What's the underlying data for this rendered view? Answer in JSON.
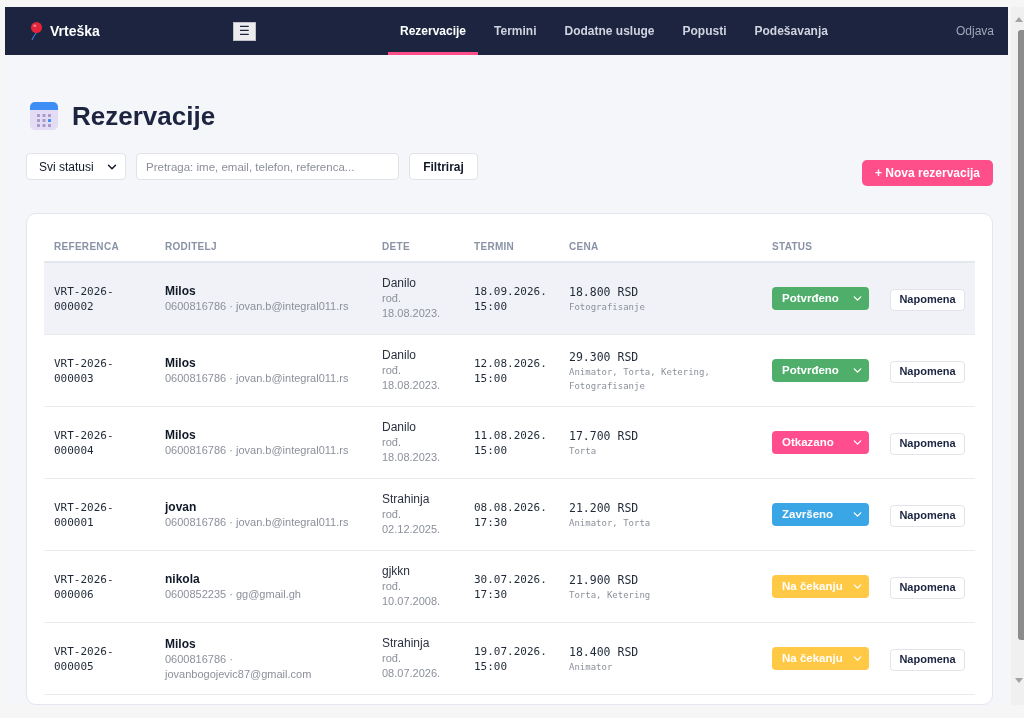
{
  "nav": {
    "brand": "Vrteška",
    "menu_button": "☰",
    "links": [
      {
        "label": "Rezervacije",
        "selected": true
      },
      {
        "label": "Termini",
        "selected": false
      },
      {
        "label": "Dodatne usluge",
        "selected": false
      },
      {
        "label": "Popusti",
        "selected": false
      },
      {
        "label": "Podešavanja",
        "selected": false
      }
    ],
    "logout": "Odjava"
  },
  "page": {
    "title": "Rezervacije"
  },
  "filters": {
    "status_select": "Svi statusi",
    "search": {
      "placeholder": "Pretraga: ime, email, telefon, referenca..."
    },
    "filter_button": "Filtriraj",
    "new_button": "+ Nova rezervacija"
  },
  "table": {
    "columns": [
      "REFERENCA",
      "RODITELJ",
      "DETE",
      "TERMIN",
      "CENA",
      "STATUS"
    ],
    "rows": [
      {
        "reference": "VRT-2026-000002",
        "parent_name": "Milos",
        "parent_contact": "0600816786 · jovan.b@integral011.rs",
        "child_name": "Danilo",
        "child_birth": "rođ. 18.08.2023.",
        "term": "18.09.2026. 15:00",
        "price": "18.800 RSD",
        "extras": "Fotografisanje",
        "status": {
          "label": "Potvrđeno",
          "color": "#4eae6a"
        },
        "note_button": "Napomena",
        "highlighted": true
      },
      {
        "reference": "VRT-2026-000003",
        "parent_name": "Milos",
        "parent_contact": "0600816786 · jovan.b@integral011.rs",
        "child_name": "Danilo",
        "child_birth": "rođ. 18.08.2023.",
        "term": "12.08.2026. 15:00",
        "price": "29.300 RSD",
        "extras": "Animator, Torta, Ketering, Fotografisanje",
        "status": {
          "label": "Potvrđeno",
          "color": "#4eae6a"
        },
        "note_button": "Napomena",
        "highlighted": false
      },
      {
        "reference": "VRT-2026-000004",
        "parent_name": "Milos",
        "parent_contact": "0600816786 · jovan.b@integral011.rs",
        "child_name": "Danilo",
        "child_birth": "rođ. 18.08.2023.",
        "term": "11.08.2026. 15:00",
        "price": "17.700 RSD",
        "extras": "Torta",
        "status": {
          "label": "Otkazano",
          "color": "#ff4d8d"
        },
        "note_button": "Napomena",
        "highlighted": false
      },
      {
        "reference": "VRT-2026-000001",
        "parent_name": "jovan",
        "parent_contact": "0600816786 · jovan.b@integral011.rs",
        "child_name": "Strahinja",
        "child_birth": "rođ. 02.12.2025.",
        "term": "08.08.2026. 17:30",
        "price": "21.200 RSD",
        "extras": "Animator, Torta",
        "status": {
          "label": "Završeno",
          "color": "#3aa6e6"
        },
        "note_button": "Napomena",
        "highlighted": false
      },
      {
        "reference": "VRT-2026-000006",
        "parent_name": "nikola",
        "parent_contact": "0600852235 · gg@gmail.gh",
        "child_name": "gjkkn",
        "child_birth": "rođ. 10.07.2008.",
        "term": "30.07.2026. 17:30",
        "price": "21.900 RSD",
        "extras": "Torta, Ketering",
        "status": {
          "label": "Na čekanju",
          "color": "#ffc845"
        },
        "note_button": "Napomena",
        "highlighted": false
      },
      {
        "reference": "VRT-2026-000005",
        "parent_name": "Milos",
        "parent_contact": "0600816786 · jovanbogojevic87@gmail.com",
        "child_name": "Strahinja",
        "child_birth": "rođ. 08.07.2026.",
        "term": "19.07.2026. 15:00",
        "price": "18.400 RSD",
        "extras": "Animator",
        "status": {
          "label": "Na čekanju",
          "color": "#ffc845"
        },
        "note_button": "Napomena",
        "highlighted": false
      }
    ]
  }
}
